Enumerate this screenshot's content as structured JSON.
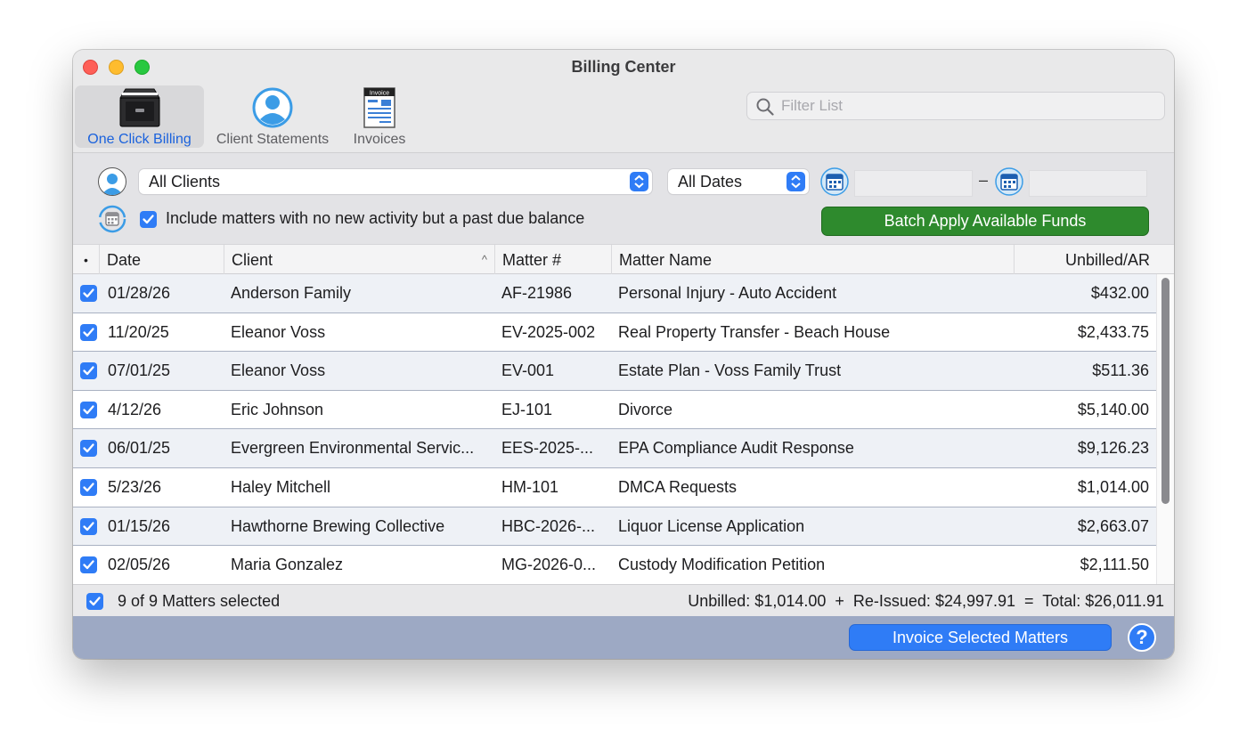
{
  "window": {
    "title": "Billing Center"
  },
  "toolbar": {
    "one_click_billing": "One Click Billing",
    "client_statements": "Client Statements",
    "invoices": "Invoices",
    "invoice_icon_text": "Invoice",
    "filter_placeholder": "Filter List"
  },
  "filters": {
    "client_select": "All Clients",
    "date_select": "All Dates",
    "date_from": "",
    "date_to": "",
    "date_separator": "–",
    "include_label": "Include matters with no new activity but a past due balance",
    "include_checked": true,
    "batch_button": "Batch Apply Available Funds"
  },
  "table": {
    "headers": {
      "dot": "•",
      "date": "Date",
      "client": "Client",
      "client_sort": "^",
      "matter": "Matter #",
      "name": "Matter Name",
      "ar": "Unbilled/AR"
    },
    "rows": [
      {
        "checked": true,
        "date": "01/28/26",
        "client": "Anderson Family",
        "matter": "AF-21986",
        "name": "Personal Injury - Auto Accident",
        "ar": "$432.00"
      },
      {
        "checked": true,
        "date": "11/20/25",
        "client": "Eleanor Voss",
        "matter": "EV-2025-002",
        "name": "Real Property Transfer - Beach House",
        "ar": "$2,433.75"
      },
      {
        "checked": true,
        "date": "07/01/25",
        "client": "Eleanor Voss",
        "matter": "EV-001",
        "name": "Estate Plan - Voss Family Trust",
        "ar": "$511.36"
      },
      {
        "checked": true,
        "date": "4/12/26",
        "client": "Eric Johnson",
        "matter": "EJ-101",
        "name": "Divorce",
        "ar": "$5,140.00"
      },
      {
        "checked": true,
        "date": "06/01/25",
        "client": "Evergreen Environmental Servic...",
        "matter": "EES-2025-...",
        "name": "EPA Compliance Audit Response",
        "ar": "$9,126.23"
      },
      {
        "checked": true,
        "date": "5/23/26",
        "client": "Haley Mitchell",
        "matter": "HM-101",
        "name": "DMCA Requests",
        "ar": "$1,014.00"
      },
      {
        "checked": true,
        "date": "01/15/26",
        "client": "Hawthorne Brewing Collective",
        "matter": "HBC-2026-...",
        "name": "Liquor License Application",
        "ar": "$2,663.07"
      },
      {
        "checked": true,
        "date": "02/05/26",
        "client": "Maria Gonzalez",
        "matter": "MG-2026-0...",
        "name": "Custody Modification Petition",
        "ar": "$2,111.50"
      }
    ]
  },
  "summary": {
    "selected": "9 of 9 Matters selected",
    "totals": "Unbilled: $1,014.00  +  Re-Issued: $24,997.91  =  Total: $26,011.91"
  },
  "footer": {
    "invoice_button": "Invoice Selected Matters",
    "help": "?"
  },
  "colors": {
    "accent": "#2f7cf6",
    "batch_green": "#2e8a2d",
    "footer_bg": "#9da9c4"
  }
}
